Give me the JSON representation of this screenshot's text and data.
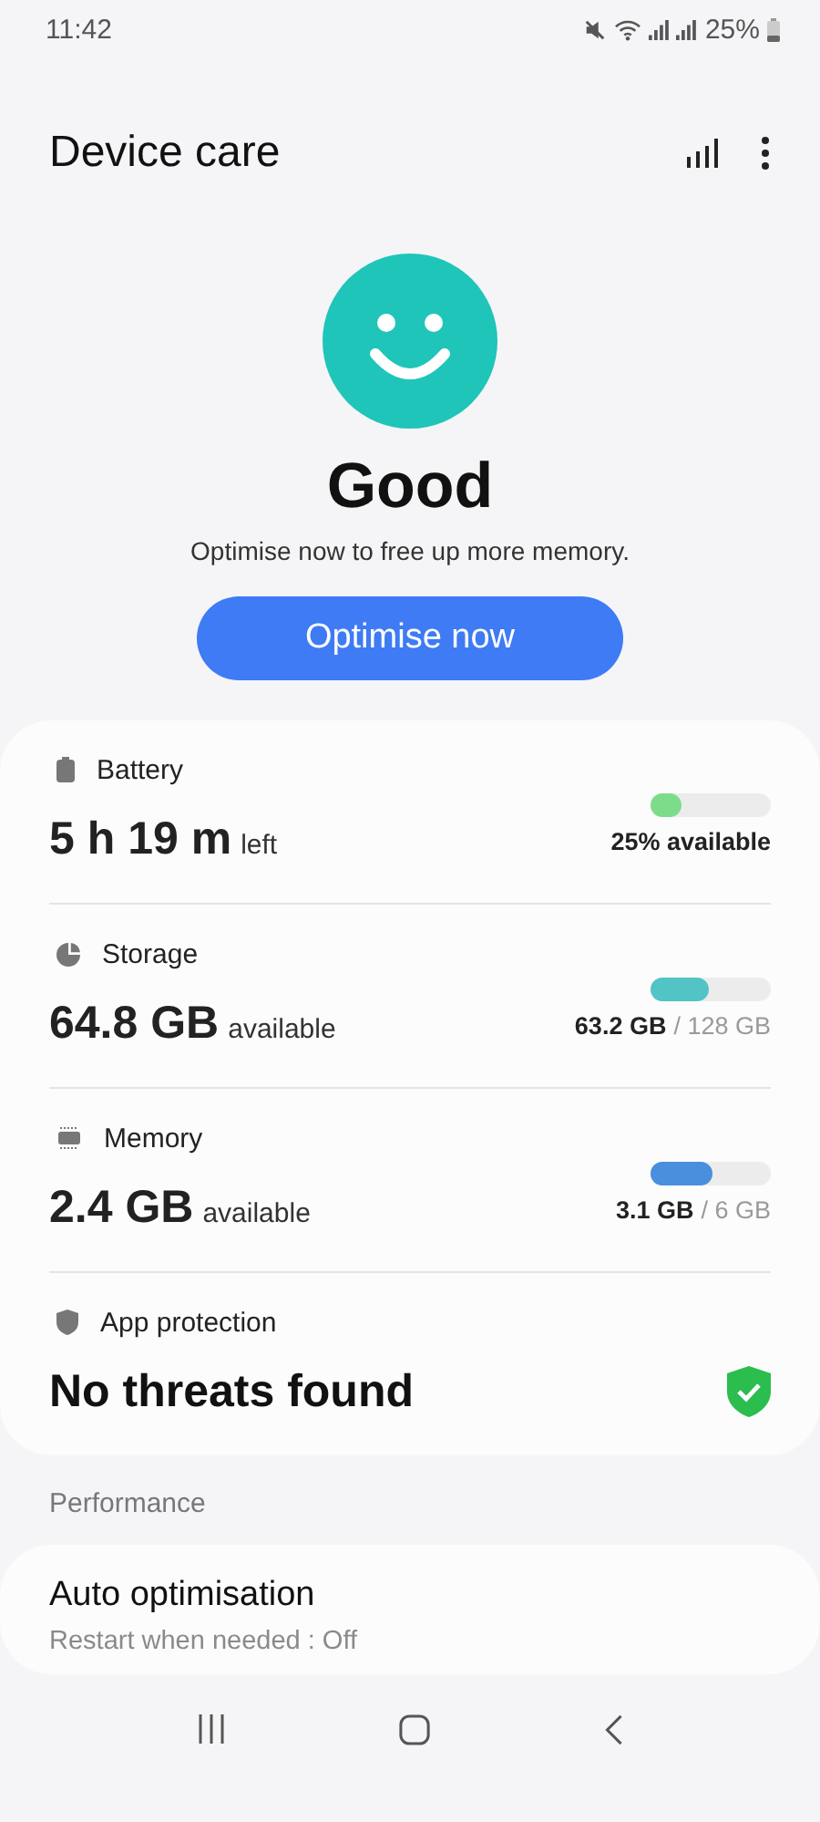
{
  "status_bar": {
    "time": "11:42",
    "battery": "25%"
  },
  "header": {
    "title": "Device care"
  },
  "summary": {
    "status": "Good",
    "message": "Optimise now to free up more memory.",
    "button": "Optimise now"
  },
  "items": [
    {
      "kind": "meter",
      "label": "Battery",
      "value": "5 h 19 m",
      "unit": "left",
      "level": 0.25,
      "color": "#7ddc8a",
      "reading": "25% available"
    },
    {
      "kind": "meter",
      "label": "Storage",
      "value": "64.8 GB",
      "unit": "available",
      "level": 0.49,
      "color": "#52c4c6",
      "reading": "63.2 GB",
      "total": "/ 128 GB"
    },
    {
      "kind": "meter",
      "label": "Memory",
      "value": "2.4 GB",
      "unit": "available",
      "level": 0.52,
      "color": "#4a8ede",
      "reading": "3.1 GB",
      "total": "/ 6 GB"
    },
    {
      "kind": "status",
      "label": "App protection",
      "value": "No threats found"
    }
  ],
  "section": "Performance",
  "settings": [
    {
      "title": "Auto optimisation",
      "summary": "Restart when needed : Off"
    }
  ]
}
